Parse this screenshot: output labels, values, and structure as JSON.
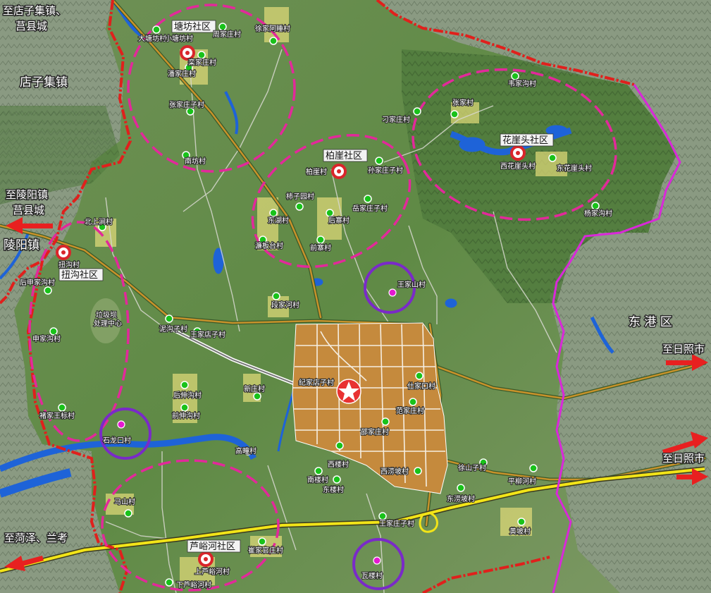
{
  "regions": {
    "dianzi": "店子集镇",
    "donggang": "东 港 区",
    "lingyang": "陵阳镇"
  },
  "directions": {
    "to_dianzi_ju_1": "至店子集镇、",
    "to_dianzi_ju_2": "莒县城",
    "to_lingyang_ju_1": "至陵阳镇",
    "to_lingyang_ju_2": "莒县城",
    "to_rizhao_1": "至日照市",
    "to_rizhao_2": "至日照市",
    "to_heze": "至菏泽、兰考"
  },
  "communities": {
    "tangfang": "塘坊社区",
    "boya": "柏崖社区",
    "huayatou": "花崖头社区",
    "niugou": "扭沟社区",
    "luyuhe": "芦峪河社区"
  },
  "special": {
    "landfill_1": "垃圾坝",
    "landfill_2": "处理中心"
  },
  "villages": {
    "datangfang": "大塘坊村",
    "xiaotangfang": "小塘坊村",
    "zhoujiazhuang": "周家庄村",
    "xujiaahu": "徐家阿睡村",
    "luanjiazhuang": "栾家庄村",
    "panjiazhuang": "潘家庄村",
    "zhangjiazhuangzi": "张家庄子村",
    "nanfang": "南坊村",
    "hanjiagou": "韦家沟村",
    "zhangjia": "张家村",
    "diaojiazhuang": "刁家庄村",
    "xihuayatou": "西花崖头村",
    "donghuayatou": "东花崖头村",
    "yangjiagou": "杨家沟村",
    "boya": "柏崖村",
    "sunjiazhuangzi": "孙家庄子村",
    "shiziyuan": "柿子园村",
    "yuejiazhuangzi": "岳家庄子村",
    "donghu": "东湖村",
    "houzhai": "后寨村",
    "hubantai": "濂板台村",
    "qianzhai": "前寨村",
    "beishangjian": "北上涧村",
    "niugou": "扭沟村",
    "houshenjiagou": "后申家沟村",
    "shenjiagou": "申家沟村",
    "chujiawangbiao": "褚家王标村",
    "wangjiashan": "王家山村",
    "duanjiahe": "段家河村",
    "nigouzi": "泥沟子村",
    "wangjiadianzi": "王家店子村",
    "xinzhuang": "新庄村",
    "houshengou": "后伸沟村",
    "qianshengou": "前伸沟村",
    "shilongkou": "石龙口村",
    "jijiadianzi": "纪家店子村",
    "shijiakou": "仕家口村",
    "fanjiazhuang": "范家庄村",
    "shaojiazhuang": "邵家庄村",
    "gaochu": "高疃村",
    "xilou": "西楼村",
    "nanlou": "南楼村",
    "donglou": "东楼村",
    "xiyongpo": "西涝坡村",
    "xushanzi": "徐山子村",
    "pingliuhe": "平柳河村",
    "dongyongpo": "东涝坡村",
    "wangjiazhuangzi": "王家庄子村",
    "huangpo": "黄坡村",
    "mashan": "马山村",
    "cuijiaguanzhuang": "崔家官庄村",
    "shangluyuhe": "上芦峪河村",
    "xialuyuhe": "下芦峪河村",
    "walou": "瓦楼村"
  },
  "colors": {
    "county_boundary": "#e0201c",
    "district_boundary": "#d928d9",
    "community_ring": "#e2299a",
    "expansion_ring": "#7a2ac8",
    "village_marker": "#19c21a",
    "expressway": "#f2e418",
    "provincial_road": "#c8922a",
    "water": "#1e63d8",
    "town_center": "#c58a3d",
    "direction_arrow": "#e82020"
  },
  "icons": {
    "town_center": "red-star-icon",
    "community_center": "community-ring-icon",
    "village": "village-dot-icon",
    "direction": "red-arrow-icon"
  }
}
